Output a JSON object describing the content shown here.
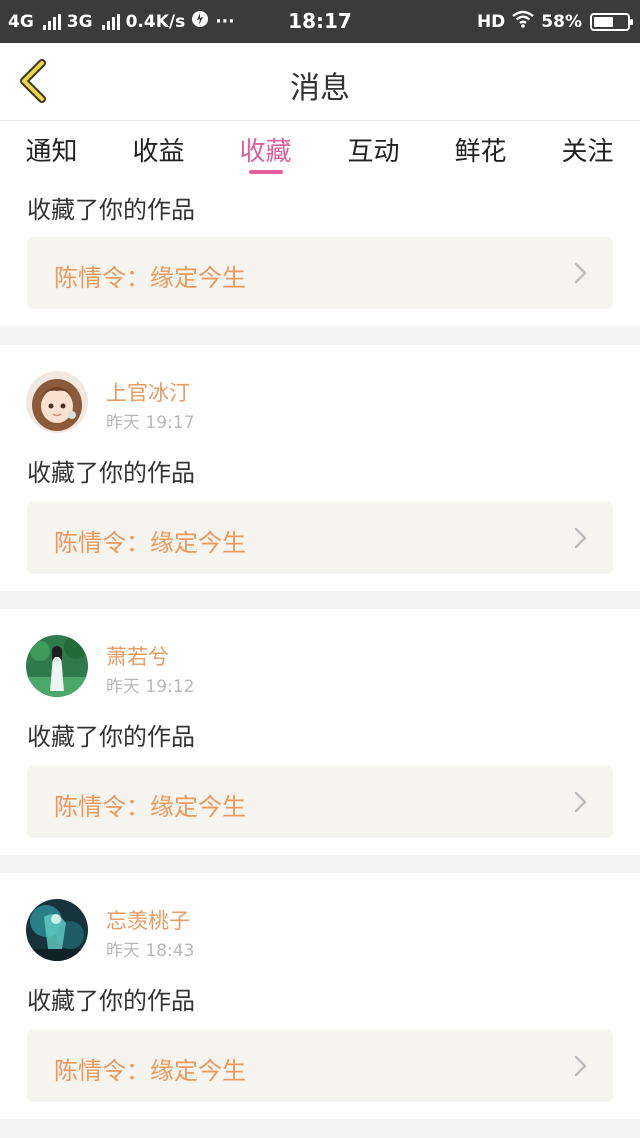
{
  "status_bar": {
    "network_1": "4G",
    "network_2": "3G",
    "speed": "0.4K/s",
    "more": "···",
    "time": "18:17",
    "hd": "HD",
    "battery_text": "58%",
    "battery_level": 0.58
  },
  "header": {
    "title": "消息"
  },
  "tabs": [
    {
      "label": "通知"
    },
    {
      "label": "收益"
    },
    {
      "label": "收藏",
      "active": true
    },
    {
      "label": "互动"
    },
    {
      "label": "鲜花"
    },
    {
      "label": "关注"
    }
  ],
  "messages": [
    {
      "action": "收藏了你的作品",
      "work_title": "陈情令：缘定今生"
    },
    {
      "user": "上官冰汀",
      "time": "昨天 19:17",
      "action": "收藏了你的作品",
      "work_title": "陈情令：缘定今生"
    },
    {
      "user": "萧若兮",
      "time": "昨天 19:12",
      "action": "收藏了你的作品",
      "work_title": "陈情令：缘定今生"
    },
    {
      "user": "忘羡桃子",
      "time": "昨天 18:43",
      "action": "收藏了你的作品",
      "work_title": "陈情令：缘定今生"
    }
  ],
  "colors": {
    "accent": "#e0609b",
    "username": "#e89b62",
    "work_title": "#ec9a5f",
    "status_bar": "#3b3b3b"
  }
}
